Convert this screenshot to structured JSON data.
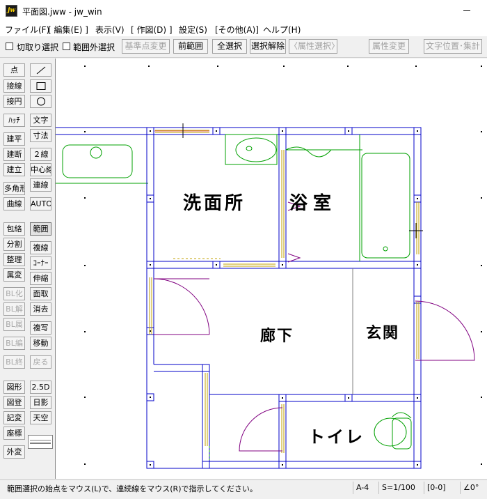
{
  "window": {
    "title": "平面図.jww - jw_win",
    "icon_text": "jw"
  },
  "menu": [
    "ファイル(F)",
    "[ 編集(E) ]",
    "表示(V)",
    "[ 作図(D) ]",
    "設定(S)",
    "[その他(A)]",
    "ヘルプ(H)"
  ],
  "toolbar": {
    "cut_select_label": "切取り選択",
    "outside_select_label": "範囲外選択",
    "base_point_label": "基準点変更",
    "prev_range_label": "前範囲",
    "select_all_label": "全選択",
    "deselect_label": "選択解除",
    "attr_select_label": "〈属性選択〉",
    "attr_change_label": "属性変更",
    "text_pos_label": "文字位置･集計"
  },
  "tools": {
    "left": [
      "点",
      "接線",
      "接円",
      "ﾊｯﾁ",
      "建平",
      "建断",
      "建立",
      "多角形",
      "曲線",
      "包絡",
      "分割",
      "整理",
      "属変",
      "BL化",
      "BL解",
      "BL属",
      "BL編",
      "BL終",
      "図形",
      "図登",
      "記変",
      "座標",
      "外変"
    ],
    "right": [
      "文字",
      "寸法",
      "２線",
      "中心線",
      "連線",
      "AUTO",
      "範囲",
      "複線",
      "ｺｰﾅｰ",
      "伸縮",
      "面取",
      "消去",
      "複写",
      "移動",
      "戻る",
      "2.5D",
      "日影",
      "天空"
    ]
  },
  "rooms": {
    "washroom": "洗面所",
    "bathroom": "浴室",
    "hallway": "廊下",
    "entrance": "玄関",
    "toilet": "トイレ"
  },
  "status": {
    "message": "範囲選択の始点をマウス(L)で、連続線をマウス(R)で指示してください。",
    "paper": "A-4",
    "scale": "S=1/100",
    "layer": "[0-0]",
    "angle": "∠0°"
  },
  "colors": {
    "wall": "#0000c8",
    "door": "#800080",
    "fixture": "#00a000",
    "opening": "#c0a000",
    "accent_text": "#000000"
  }
}
